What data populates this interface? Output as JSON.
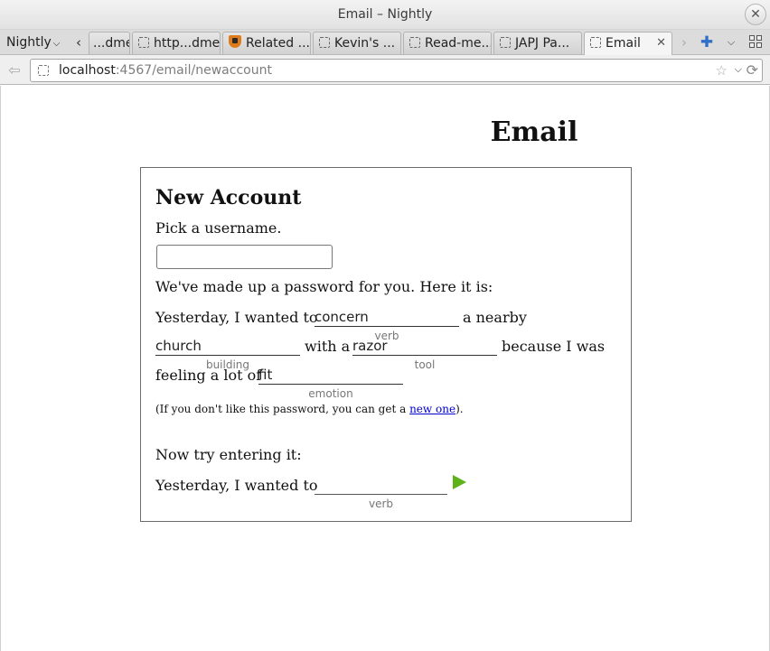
{
  "window": {
    "title": "Email – Nightly",
    "close_glyph": "✕"
  },
  "tabbar": {
    "menu_label": "Nightly",
    "tabs": [
      {
        "label": "...dme",
        "favicon": "dashed-page-icon"
      },
      {
        "label": "http...dme",
        "favicon": "dashed-page-icon"
      },
      {
        "label": "Related ...",
        "favicon": "shield-icon"
      },
      {
        "label": "Kevin's ...",
        "favicon": "dashed-page-icon"
      },
      {
        "label": "Read-me...",
        "favicon": "dashed-page-icon"
      },
      {
        "label": "JAPJ Pa...",
        "favicon": "dashed-page-icon"
      },
      {
        "label": "Email",
        "favicon": "dashed-page-icon",
        "active": true
      }
    ]
  },
  "navbar": {
    "url_host": "localhost",
    "url_rest": ":4567/email/newaccount"
  },
  "page": {
    "heading": "Email",
    "card_title": "New Account",
    "pick_username": "Pick a username.",
    "password_intro": "We've made up a password for you. Here it is:",
    "madlib": {
      "yesterday": "Yesterday, I wanted to",
      "a_nearby": "a nearby",
      "with_a": "with a",
      "because": "because I was",
      "feeling": "feeling a lot of",
      "verb_value": "concern",
      "verb_hint": "verb",
      "building_value": "church",
      "building_hint": "building",
      "tool_value": "razor",
      "tool_hint": "tool",
      "emotion_value": "fit",
      "emotion_hint": "emotion"
    },
    "note_prefix": "(If you don't like this password, you can get a ",
    "note_link": "new one",
    "note_suffix": ").",
    "try_text": "Now try entering it:",
    "try_yesterday": "Yesterday, I wanted to",
    "try_verb_hint": "verb"
  },
  "colors": {
    "link": "#0000cc",
    "submit": "#5fb31a"
  }
}
